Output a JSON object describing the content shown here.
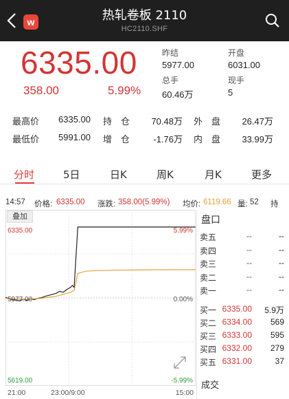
{
  "header": {
    "title": "热轧卷板 2110",
    "subtitle": "HC2110.SHF",
    "logo_letter": "w",
    "back_icon": "chevron-left-icon",
    "search_icon": "search-icon"
  },
  "quote": {
    "last_price": "6335.00",
    "change": "358.00",
    "change_pct": "5.99%",
    "prev_close_label": "昨结",
    "prev_close": "5977.00",
    "open_label": "开盘",
    "open": "6031.00",
    "volume_label": "总手",
    "volume": "60.46万",
    "cur_vol_label": "现手",
    "cur_vol": "5"
  },
  "stats": {
    "high_label": "最高价",
    "high": "6335.00",
    "low_label": "最低价",
    "low": "5991.00",
    "oi_label": "持　仓",
    "oi": "70.48万",
    "oi_chg_label": "增　仓",
    "oi_chg": "-1.76万",
    "outer_label": "外　盘",
    "outer": "26.47万",
    "inner_label": "内　盘",
    "inner": "33.99万"
  },
  "tabs": [
    "分时",
    "5日",
    "日K",
    "周K",
    "月K",
    "更多"
  ],
  "info": {
    "time": "14:57",
    "price_label": "价格:",
    "price": "6335.00",
    "chg_label": "涨跌:",
    "chg": "358.00(5.99%)",
    "avg_label": "均价:",
    "avg": "6119.66",
    "qty_label": "量:",
    "qty": "52",
    "hold_label": "持"
  },
  "chart": {
    "overlay_label": "叠加",
    "expand_icon": "expand-icon"
  },
  "chart_data": {
    "type": "line",
    "y_top": "6335.00",
    "y_mid": "5977.00",
    "y_bottom": "5619.00",
    "pct_top": "5.99%",
    "pct_mid": "0.00%",
    "pct_bottom": "-5.99%",
    "x_labels": [
      "21:00",
      "23:00/9:00",
      "15:00"
    ],
    "ylim": [
      5619,
      6335
    ],
    "series": [
      {
        "name": "价格",
        "color": "#222222",
        "points": [
          [
            0,
            5980
          ],
          [
            2,
            5972
          ],
          [
            4,
            5968
          ],
          [
            6,
            5965
          ],
          [
            8,
            5962
          ],
          [
            10,
            5970
          ],
          [
            12,
            5964
          ],
          [
            14,
            5972
          ],
          [
            16,
            5968
          ],
          [
            18,
            5975
          ],
          [
            20,
            5978
          ],
          [
            22,
            5985
          ],
          [
            24,
            5990
          ],
          [
            26,
            5995
          ],
          [
            28,
            6000
          ],
          [
            30,
            6010
          ],
          [
            32,
            6005
          ],
          [
            34,
            6020
          ],
          [
            36,
            6030
          ],
          [
            37,
            6040
          ],
          [
            38,
            6030
          ],
          [
            40,
            6335
          ],
          [
            50,
            6335
          ],
          [
            60,
            6335
          ],
          [
            70,
            6335
          ],
          [
            80,
            6335
          ],
          [
            90,
            6335
          ],
          [
            100,
            6335
          ]
        ]
      },
      {
        "name": "均价",
        "color": "#e8a03a",
        "points": [
          [
            0,
            5975
          ],
          [
            4,
            5972
          ],
          [
            8,
            5970
          ],
          [
            12,
            5970
          ],
          [
            16,
            5972
          ],
          [
            20,
            5975
          ],
          [
            24,
            5980
          ],
          [
            28,
            5985
          ],
          [
            32,
            5995
          ],
          [
            36,
            6005
          ],
          [
            38,
            6015
          ],
          [
            40,
            6100
          ],
          [
            44,
            6112
          ],
          [
            50,
            6115
          ],
          [
            60,
            6117
          ],
          [
            70,
            6118
          ],
          [
            80,
            6119
          ],
          [
            90,
            6119.66
          ],
          [
            100,
            6119.66
          ]
        ]
      }
    ]
  },
  "order_book": {
    "title": "盘口",
    "asks": [
      {
        "label": "卖五",
        "price": "--",
        "qty": "--"
      },
      {
        "label": "卖四",
        "price": "--",
        "qty": "--"
      },
      {
        "label": "卖三",
        "price": "--",
        "qty": "--"
      },
      {
        "label": "卖二",
        "price": "--",
        "qty": "--"
      },
      {
        "label": "卖一",
        "price": "--",
        "qty": "--"
      }
    ],
    "bids": [
      {
        "label": "买一",
        "price": "6335.00",
        "qty": "5.9万"
      },
      {
        "label": "买二",
        "price": "6334.00",
        "qty": "569"
      },
      {
        "label": "买三",
        "price": "6333.00",
        "qty": "595"
      },
      {
        "label": "买四",
        "price": "6332.00",
        "qty": "279"
      },
      {
        "label": "买五",
        "price": "6331.00",
        "qty": "37"
      }
    ],
    "trades_label": "成交"
  },
  "colors": {
    "up": "#d23535",
    "down": "#2e9a3e",
    "avg_line": "#e8a03a",
    "header_bg": "#1f1f1f"
  }
}
